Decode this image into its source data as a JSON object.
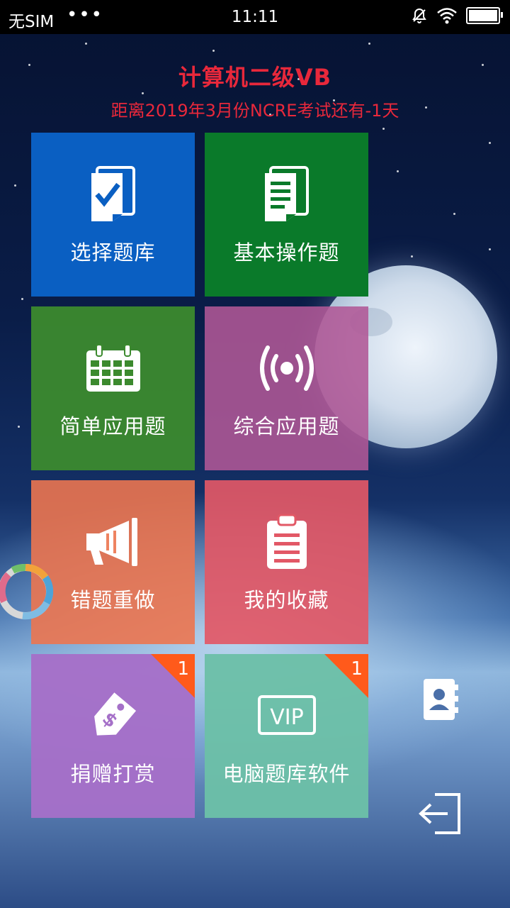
{
  "status_bar": {
    "carrier": "无SIM",
    "dots": "•••",
    "time": "11:11"
  },
  "header": {
    "title": "计算机二级VB",
    "subtitle": "距离2019年3月份NCRE考试还有-1天"
  },
  "tiles": [
    {
      "label": "选择题库",
      "icon": "check-document-icon",
      "color": "#0a5fc2"
    },
    {
      "label": "基本操作题",
      "icon": "notes-document-icon",
      "color": "#0a7a2a"
    },
    {
      "label": "简单应用题",
      "icon": "calendar-icon",
      "color": "#3c8a2e"
    },
    {
      "label": "综合应用题",
      "icon": "broadcast-icon",
      "color": "#a35288"
    },
    {
      "label": "错题重做",
      "icon": "megaphone-icon",
      "color": "#e6704e"
    },
    {
      "label": "我的收藏",
      "icon": "clipboard-icon",
      "color": "#de5a67"
    },
    {
      "label": "捐赠打赏",
      "icon": "price-tag-icon",
      "color": "#a570c8",
      "badge": "1"
    },
    {
      "label": "电脑题库软件",
      "icon": "vip-icon",
      "color": "#6cc0a8",
      "badge": "1"
    }
  ],
  "side": {
    "contacts_icon": "contacts-icon",
    "exit_icon": "exit-icon"
  }
}
